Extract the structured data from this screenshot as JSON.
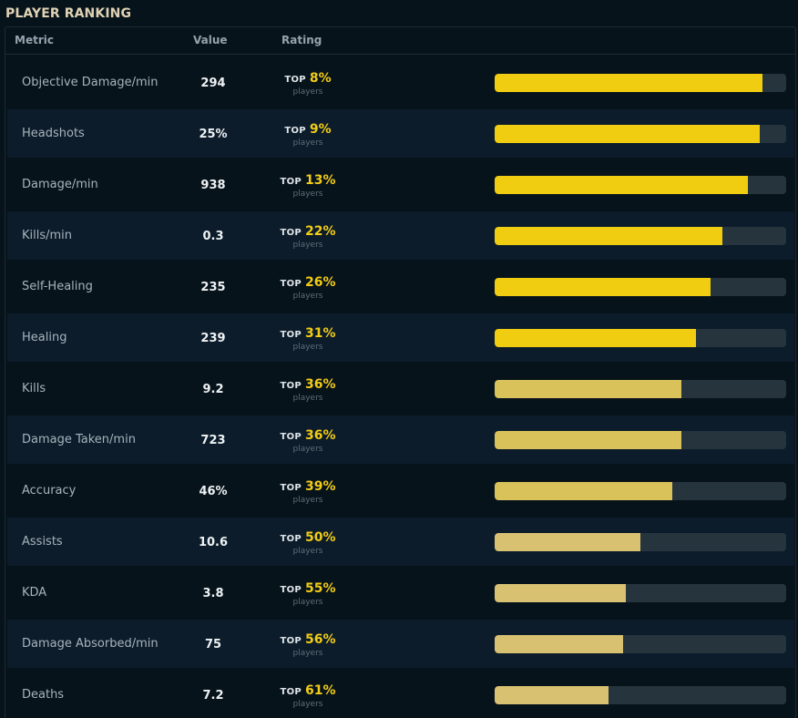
{
  "page": {
    "title": "PLAYER RANKING"
  },
  "table": {
    "columns": {
      "metric": "Metric",
      "value": "Value",
      "rating": "Rating"
    },
    "top_word": "TOP",
    "players_word": "players",
    "bar_colors": {
      "track": "#26343e",
      "fill_strong": "#f0cd10",
      "fill_mid": "#d9c25a",
      "fill_light": "#d8c272"
    },
    "rows": [
      {
        "metric": "Objective Damage/min",
        "value": "294",
        "rating": "8%",
        "fill": 0.92
      },
      {
        "metric": "Headshots",
        "value": "25%",
        "rating": "9%",
        "fill": 0.91
      },
      {
        "metric": "Damage/min",
        "value": "938",
        "rating": "13%",
        "fill": 0.87
      },
      {
        "metric": "Kills/min",
        "value": "0.3",
        "rating": "22%",
        "fill": 0.78
      },
      {
        "metric": "Self-Healing",
        "value": "235",
        "rating": "26%",
        "fill": 0.74
      },
      {
        "metric": "Healing",
        "value": "239",
        "rating": "31%",
        "fill": 0.69
      },
      {
        "metric": "Kills",
        "value": "9.2",
        "rating": "36%",
        "fill": 0.64
      },
      {
        "metric": "Damage Taken/min",
        "value": "723",
        "rating": "36%",
        "fill": 0.64
      },
      {
        "metric": "Accuracy",
        "value": "46%",
        "rating": "39%",
        "fill": 0.61
      },
      {
        "metric": "Assists",
        "value": "10.6",
        "rating": "50%",
        "fill": 0.5
      },
      {
        "metric": "KDA",
        "value": "3.8",
        "rating": "55%",
        "fill": 0.45
      },
      {
        "metric": "Damage Absorbed/min",
        "value": "75",
        "rating": "56%",
        "fill": 0.44
      },
      {
        "metric": "Deaths",
        "value": "7.2",
        "rating": "61%",
        "fill": 0.39
      }
    ]
  }
}
